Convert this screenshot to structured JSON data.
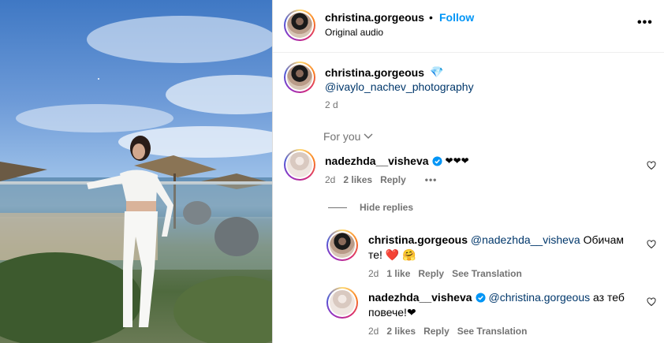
{
  "header": {
    "username": "christina.gorgeous",
    "separator": "•",
    "follow_label": "Follow",
    "audio": "Original audio",
    "more_icon": "more-horizontal-icon"
  },
  "caption": {
    "username": "christina.gorgeous",
    "emoji": "💎",
    "mention": "@ivaylo_nachev_photography",
    "time": "2 d"
  },
  "sort": {
    "label": "For you",
    "icon": "chevron-down-icon"
  },
  "comments": [
    {
      "username": "nadezhda__visheva",
      "text": "❤❤❤",
      "time": "2d",
      "likes": "2 likes",
      "reply_label": "Reply",
      "more": "•••"
    }
  ],
  "hide_replies": "Hide replies",
  "replies": [
    {
      "username": "christina.gorgeous",
      "mention": "@nadezhda__visheva",
      "text_line1": " Обичам",
      "text_line2": "те! ❤️ 🤗",
      "time": "2d",
      "likes": "1 like",
      "reply_label": "Reply",
      "translation": "See Translation"
    },
    {
      "username": "nadezhda__visheva",
      "mention": "@christina.gorgeous",
      "text_line1": " аз теб",
      "text_line2": "повече!❤",
      "time": "2d",
      "likes": "2 likes",
      "reply_label": "Reply",
      "translation": "See Translation"
    }
  ],
  "colors": {
    "follow": "#0095f6",
    "link": "#00376b",
    "verified": "#0095f6",
    "muted": "#737373"
  }
}
